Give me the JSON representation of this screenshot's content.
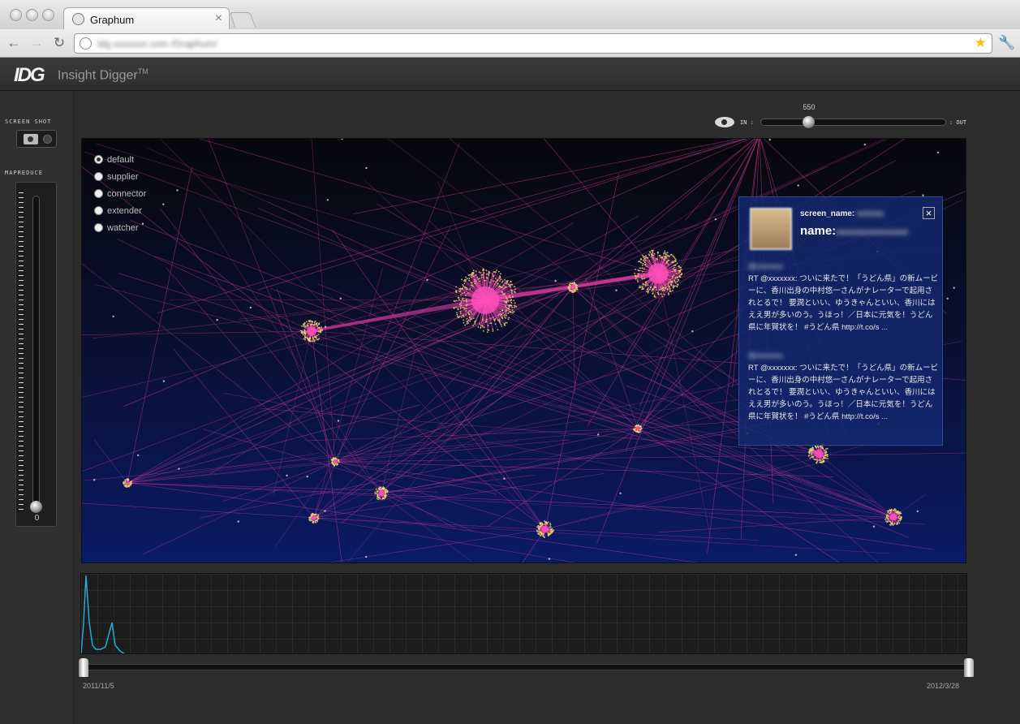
{
  "browser": {
    "tab_title": "Graphum",
    "url": "idg.xxxxxxx.com /Graphum/",
    "tab_close": "×"
  },
  "app": {
    "logo": "IDG",
    "name": "Insight Digger",
    "trademark": "TM"
  },
  "left_panel": {
    "screenshot_label": "SCREEN SHOT",
    "mapreduce_label": "MAPREDUCE",
    "mapreduce_value": "0",
    "mapreduce_level": 0
  },
  "zoom": {
    "in_label": "IN :",
    "out_label": ": OUT",
    "value": "550"
  },
  "modes": [
    {
      "label": "default",
      "selected": true
    },
    {
      "label": "supplier",
      "selected": false
    },
    {
      "label": "connector",
      "selected": false
    },
    {
      "label": "extender",
      "selected": false
    },
    {
      "label": "watcher",
      "selected": false
    }
  ],
  "popup": {
    "screen_name_label": "screen_name:",
    "screen_name_value": "xxxxxx",
    "name_label": "name:",
    "name_value": "xxxxxxxxxxxxxxxx",
    "close": "×",
    "tweets": [
      {
        "user": "@xxxxxxx",
        "text": "RT @xxxxxxx: ついに来たで！「うどん県」の新ムービーに、香川出身の中村悠一さんがナレーターで起用されとるで！ 要潤といい、ゆうきゃんといい、香川にはええ男が多いのう。うほっ！／日本に元気を！うどん県に年賀状を！ #うどん県 http://t.co/s ..."
      },
      {
        "user": "@xxxxxxx",
        "text": "RT @xxxxxxx: ついに来たで！「うどん県」の新ムービーに、香川出身の中村悠一さんがナレーターで起用されとるで！ 要潤といい、ゆうきゃんといい、香川にはええ男が多いのう。うほっ！／日本に元気を！うどん県に年賀状を！ #うどん県 http://t.co/s ..."
      }
    ]
  },
  "timeline": {
    "start_label": "2011/11/5",
    "end_label": "2012/3/28",
    "line_color": "#2aa7d6"
  },
  "colors": {
    "edge": "#d43a9c",
    "node": "#ff4fb8",
    "halo": "#e8e070"
  }
}
